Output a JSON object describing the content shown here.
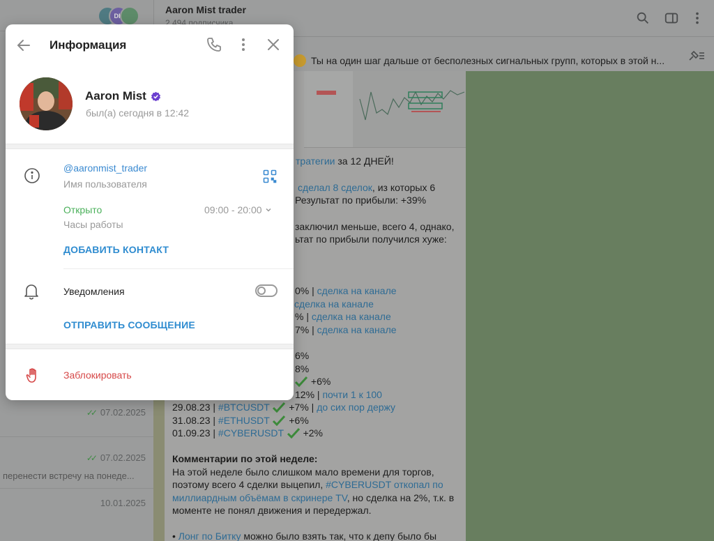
{
  "channel": {
    "title": "Aaron Mist trader",
    "subscribers": "2 494 подписчика",
    "avatar_badge": "DK"
  },
  "chat_list": {
    "dates": [
      "07.02.2025",
      "07.02.2025",
      "10.01.2025"
    ],
    "snippet": "перенести встречу на понеде..."
  },
  "pinned": {
    "text": "Ты на один шаг дальше от бесполезных сигнальных групп, которых в этой н..."
  },
  "message": {
    "l1a": "тратегии",
    "l1b": " за 12 ДНЕЙ!",
    "l2a": "сделал 8 сделок",
    "l2b": ", из которых 6",
    "l3": "Результат по прибыли: +39%",
    "l4": "заключил меньше, всего 4, однако,",
    "l5": "ьтат по прибыли получился хуже:",
    "r1a": "0% | ",
    "r1b": "сделка на канале",
    "r2b": "сделка на канале",
    "r3a": "% | ",
    "r3b": "сделка на канале",
    "r4a": "7% | ",
    "r4b": "сделка на канале",
    "r5": "6%",
    "r6": "8%",
    "r7": "+6%",
    "r8a": "12% | ",
    "r8b": "почти 1 к 100",
    "t1d": "29.08.23 | ",
    "t1t": "#BTCUSDT",
    "t1v": " +7% | ",
    "t1l": "до сих пор держу",
    "t2d": "31.08.23 | ",
    "t2t": "#ETHUSDT",
    "t2v": " +6%",
    "t3d": "01.09.23 | ",
    "t3t": "#CYBERUSDT",
    "t3v": " +2%",
    "c_title": "Комментарии по этой неделе:",
    "c1": "На этой неделе было слишком мало времени для торгов,",
    "c2a": "поэтому всего 4 сделки выцепил, ",
    "c2b": "#CYBERUSDT",
    "c2c": " откопал по",
    "c3a": "миллиардным объёмам в скринере TV",
    "c3b": ", но сделка на 2%, т.к. в",
    "c4": "моменте не понял движения и передержал.",
    "c5a": "• ",
    "c5b": "Лонг по Битку",
    "c5c": " можно было взять так, что к депу было бы"
  },
  "dialog": {
    "title": "Информация",
    "name": "Aaron Mist",
    "last_seen": "был(а) сегодня в 12:42",
    "username": "@aaronmist_trader",
    "username_label": "Имя пользователя",
    "open_status": "Открыто",
    "hours": "09:00 - 20:00",
    "hours_label": "Часы работы",
    "add_contact": "ДОБАВИТЬ КОНТАКТ",
    "notifications": "Уведомления",
    "notifications_on": false,
    "send_message": "ОТПРАВИТЬ СООБЩЕНИЕ",
    "block": "Заблокировать"
  },
  "colors": {
    "accent": "#2f8cd0",
    "link": "#3a8ad1",
    "open_green": "#4ab05a",
    "danger": "#d64848",
    "verified_purple": "#6b3fcf"
  }
}
